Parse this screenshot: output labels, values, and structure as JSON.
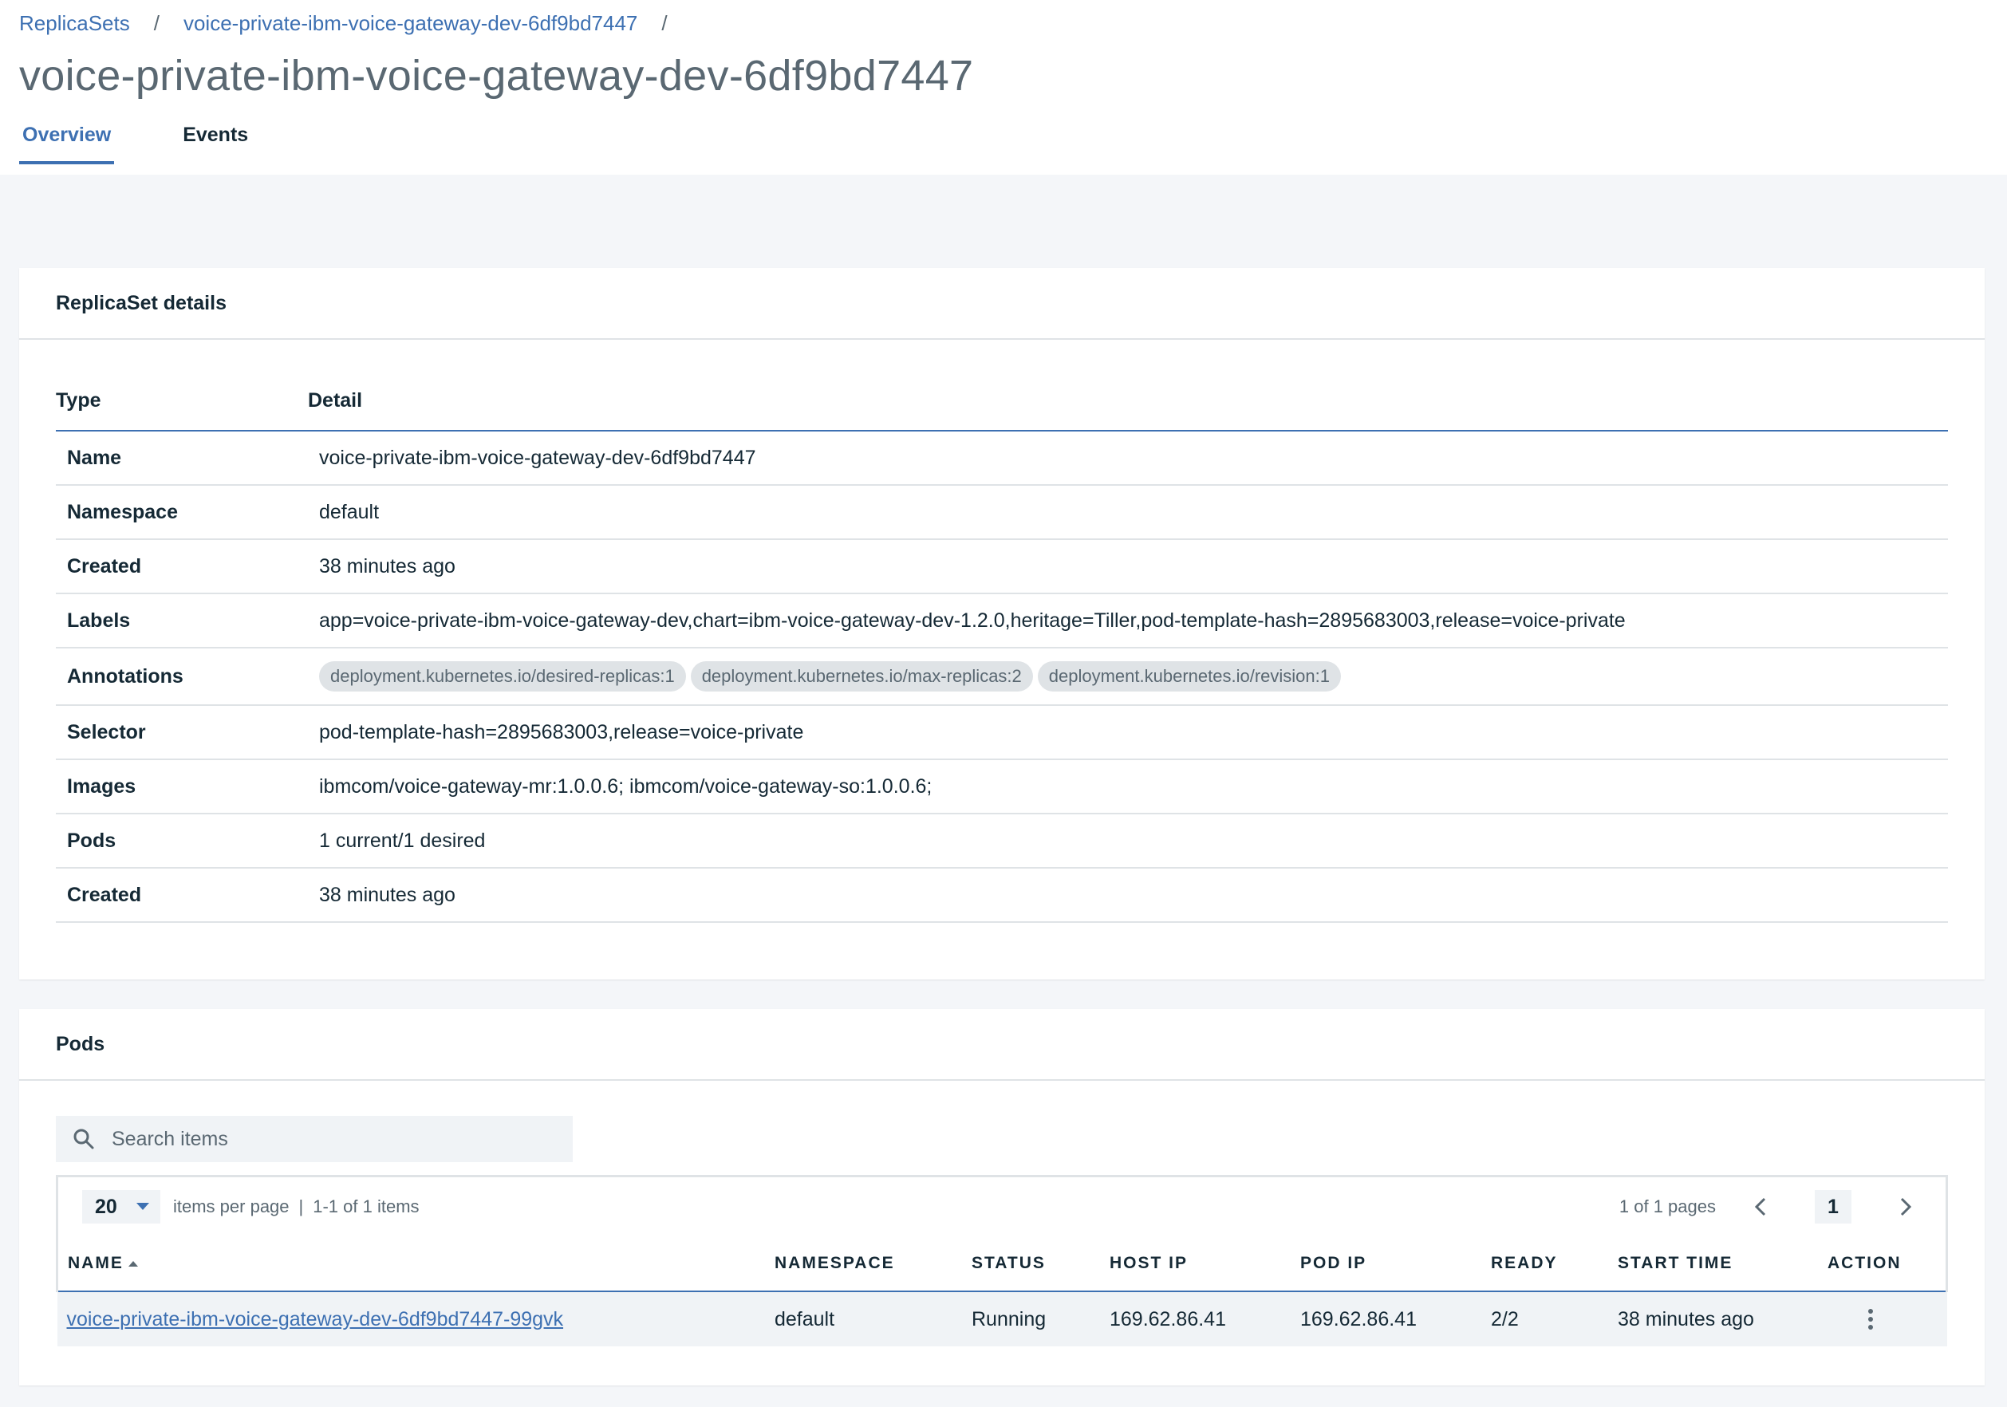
{
  "breadcrumb": {
    "root": "ReplicaSets",
    "current": "voice-private-ibm-voice-gateway-dev-6df9bd7447",
    "separator": "/"
  },
  "page_title": "voice-private-ibm-voice-gateway-dev-6df9bd7447",
  "tabs": [
    {
      "label": "Overview",
      "active": true
    },
    {
      "label": "Events",
      "active": false
    }
  ],
  "details": {
    "title": "ReplicaSet details",
    "col_type": "Type",
    "col_detail": "Detail",
    "rows": [
      {
        "key": "Name",
        "value": "voice-private-ibm-voice-gateway-dev-6df9bd7447"
      },
      {
        "key": "Namespace",
        "value": "default"
      },
      {
        "key": "Created",
        "value": "38 minutes ago"
      },
      {
        "key": "Labels",
        "value": "app=voice-private-ibm-voice-gateway-dev,chart=ibm-voice-gateway-dev-1.2.0,heritage=Tiller,pod-template-hash=2895683003,release=voice-private"
      },
      {
        "key": "Annotations",
        "tags": [
          "deployment.kubernetes.io/desired-replicas:1",
          "deployment.kubernetes.io/max-replicas:2",
          "deployment.kubernetes.io/revision:1"
        ]
      },
      {
        "key": "Selector",
        "value": "pod-template-hash=2895683003,release=voice-private"
      },
      {
        "key": "Images",
        "value": "ibmcom/voice-gateway-mr:1.0.0.6; ibmcom/voice-gateway-so:1.0.0.6;"
      },
      {
        "key": "Pods",
        "value": "1 current/1 desired"
      },
      {
        "key": "Created",
        "value": "38 minutes ago"
      }
    ]
  },
  "pods": {
    "title": "Pods",
    "search_placeholder": "Search items",
    "pager": {
      "per_page": "20",
      "per_page_label": "items per page",
      "separator": "|",
      "range": "1-1 of 1 items",
      "pages_label": "1 of 1 pages",
      "current_page": "1"
    },
    "columns": [
      "NAME",
      "NAMESPACE",
      "STATUS",
      "HOST IP",
      "POD IP",
      "READY",
      "START TIME",
      "ACTION"
    ],
    "rows": [
      {
        "name": "voice-private-ibm-voice-gateway-dev-6df9bd7447-99gvk",
        "namespace": "default",
        "status": "Running",
        "host_ip": "169.62.86.41",
        "pod_ip": "169.62.86.41",
        "ready": "2/2",
        "start_time": "38 minutes ago"
      }
    ]
  },
  "colors": {
    "accent": "#3d70b2",
    "text": "#152935",
    "muted": "#5a6872",
    "background": "#f4f6f9",
    "row_bg": "#f0f3f6"
  }
}
